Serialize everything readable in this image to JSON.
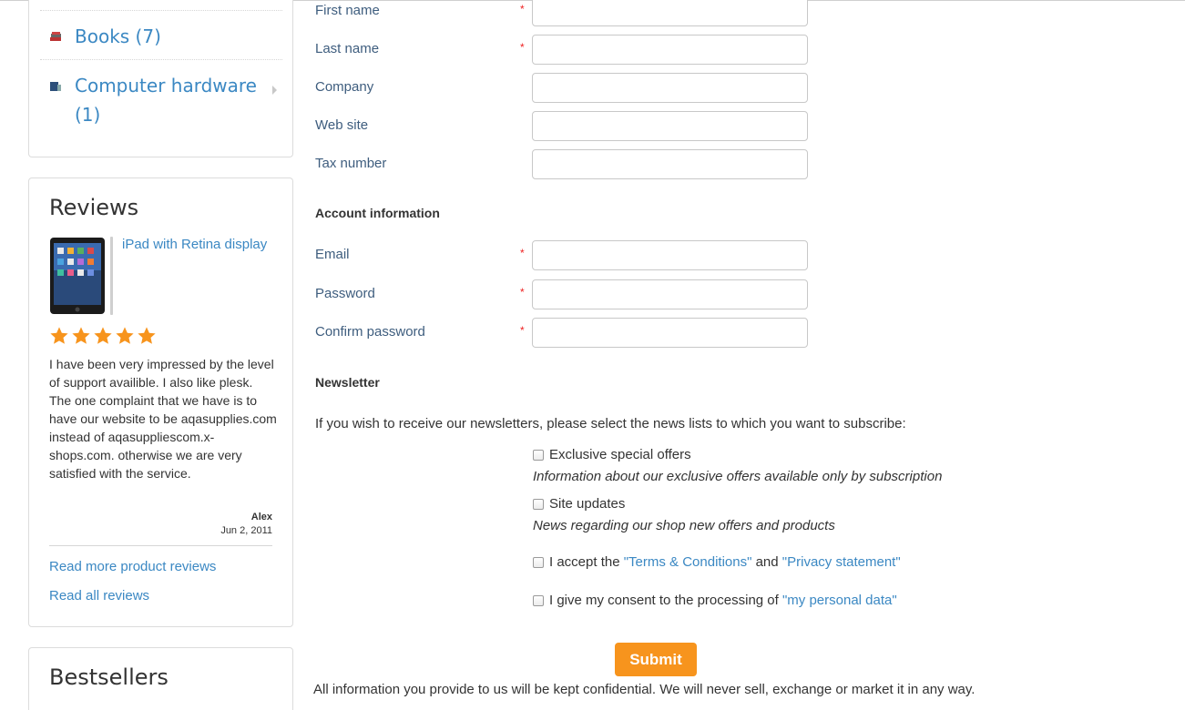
{
  "sidebar": {
    "categories": [
      {
        "label": "Books (7)",
        "icon": "books-icon"
      },
      {
        "label_line1": "Computer hardware",
        "label_line2": "(1)",
        "icon": "hardware-icon"
      }
    ],
    "reviews": {
      "title": "Reviews",
      "product": "iPad with Retina display",
      "rating": 5,
      "rating_max": 5,
      "text": "I have been very impressed by the level of support availible. I also like plesk. The one complaint that we have is to have our website to be aqasupplies.com instead of aqasuppliescom.x-shops.com. otherwise we are very satisfied with the service.",
      "author": "Alex",
      "date": "Jun 2, 2011",
      "read_more": "Read more product reviews",
      "read_all": "Read all reviews"
    },
    "bestsellers": {
      "title": "Bestsellers"
    }
  },
  "form": {
    "fields_personal": [
      {
        "label": "First name",
        "required": true,
        "value": ""
      },
      {
        "label": "Last name",
        "required": true,
        "value": ""
      },
      {
        "label": "Company",
        "required": false,
        "value": ""
      },
      {
        "label": "Web site",
        "required": false,
        "value": ""
      },
      {
        "label": "Tax number",
        "required": false,
        "value": ""
      }
    ],
    "account_title": "Account information",
    "fields_account": [
      {
        "label": "Email",
        "required": true,
        "value": ""
      },
      {
        "label": "Password",
        "required": true,
        "value": ""
      },
      {
        "label": "Confirm password",
        "required": true,
        "value": ""
      }
    ],
    "required_mark": "*",
    "newsletter_title": "Newsletter",
    "newsletter_intro": "If you wish to receive our newsletters, please select the news lists to which you want to subscribe:",
    "newsletters": [
      {
        "label": "Exclusive special offers",
        "desc": "Information about our exclusive offers available only by subscription",
        "checked": false
      },
      {
        "label": "Site updates",
        "desc": "News regarding our shop new offers and products",
        "checked": false
      }
    ],
    "terms": {
      "prefix": "I accept the ",
      "terms_link": "\"Terms & Conditions\"",
      "and": " and ",
      "privacy_link": "\"Privacy statement\"",
      "checked": false
    },
    "consent": {
      "prefix": "I give my consent to the processing of ",
      "link": "\"my personal data\"",
      "checked": false
    },
    "submit_label": "Submit",
    "confidential": "All information you provide to us will be kept confidential. We will never sell, exchange or market it in any way."
  },
  "colors": {
    "link": "#3b88c3",
    "accent": "#f7941d",
    "required": "#ee2222",
    "star": "#f7941d"
  }
}
